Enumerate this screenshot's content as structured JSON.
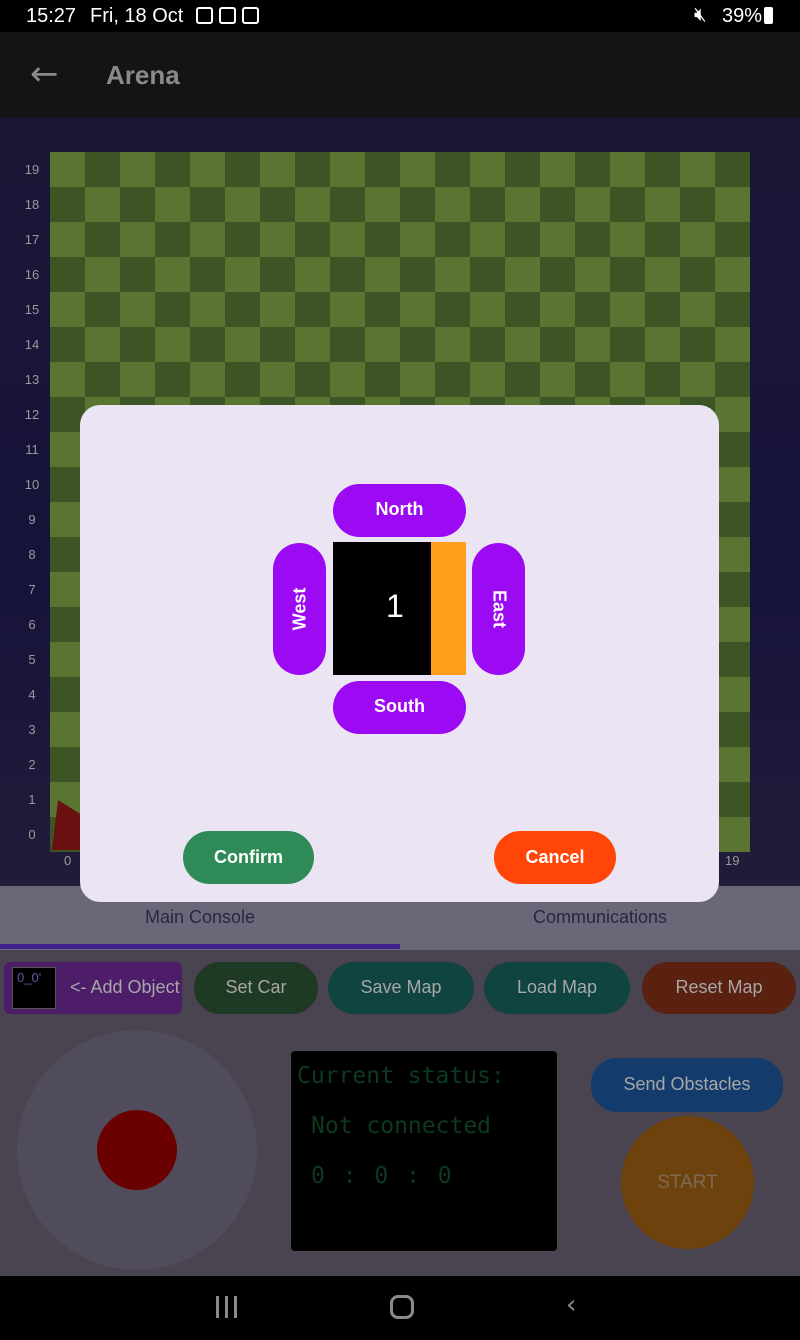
{
  "status_bar": {
    "time": "15:27",
    "date": "Fri, 18 Oct",
    "battery": "39%",
    "notification_icons": [
      "gallery-icon",
      "camera-icon",
      "play-store-icon"
    ],
    "mute_icon": "mute-icon"
  },
  "app_bar": {
    "title": "Arena",
    "back_icon": "arrow-left-icon"
  },
  "arena": {
    "y_labels": [
      "19",
      "18",
      "17",
      "16",
      "15",
      "14",
      "13",
      "12",
      "11",
      "10",
      "9",
      "8",
      "7",
      "6",
      "5",
      "4",
      "3",
      "2",
      "1",
      "0"
    ],
    "x_labels": [
      "0",
      "19"
    ],
    "grid_size": 20,
    "colors": {
      "light": "#5a7532",
      "dark": "#3d5525"
    }
  },
  "tabs": {
    "main": "Main Console",
    "comm": "Communications"
  },
  "controls": {
    "add_object_thumb": "0_0'",
    "add_object": "<- Add Object",
    "set_car": "Set Car",
    "save_map": "Save Map",
    "load_map": "Load Map",
    "reset_map": "Reset Map",
    "send_obstacles": "Send Obstacles",
    "start": "START"
  },
  "status_panel": {
    "heading": "Current status:",
    "status": "Not connected",
    "timer": "0 : 0 : 0"
  },
  "dialog": {
    "north": "North",
    "south": "South",
    "west": "West",
    "east": "East",
    "obstacle_number": "1",
    "obstacle_color": "#000000",
    "face_color": "#ff9f1c",
    "confirm": "Confirm",
    "cancel": "Cancel"
  },
  "colors": {
    "direction_button": "#9b0af2",
    "confirm": "#2e8b57",
    "cancel": "#ff4507"
  },
  "nav_bar": {
    "icons": [
      "recents-icon",
      "home-icon",
      "back-icon"
    ]
  }
}
